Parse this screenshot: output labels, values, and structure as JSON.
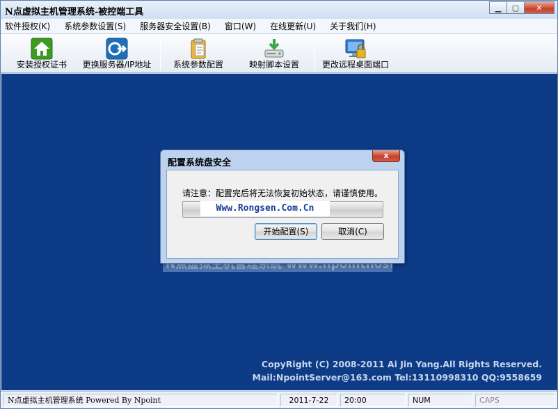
{
  "window": {
    "title": "N点虚拟主机管理系统-被控端工具",
    "minimize_glyph": "▁",
    "maximize_glyph": "▢",
    "close_glyph": "✕"
  },
  "menu": {
    "items": [
      {
        "label": "软件授权(K)"
      },
      {
        "label": "系统参数设置(S)"
      },
      {
        "label": "服务器安全设置(B)"
      },
      {
        "label": "窗口(W)"
      },
      {
        "label": "在线更新(U)"
      },
      {
        "label": "关于我们(H)"
      }
    ]
  },
  "toolbar": {
    "items": [
      {
        "label": "安装授权证书",
        "icon": "home-icon",
        "color": "#3c9b25"
      },
      {
        "label": "更换服务器/IP地址",
        "icon": "server-arrow-icon",
        "color": "#1e6fb8"
      },
      {
        "label": "系统参数配置",
        "icon": "clipboard-icon",
        "color": "#d9a72b"
      },
      {
        "label": "映射脚本设置",
        "icon": "download-drive-icon",
        "color": "#3aa64a"
      },
      {
        "label": "更改远程桌面端口",
        "icon": "monitor-lock-icon",
        "color": "#2d7bd6"
      }
    ]
  },
  "main": {
    "background_color": "#0e3b86",
    "watermark_text": "N点虚拟主机管理系统 www.npointhost.com",
    "copyright_line1": "CopyRight (C) 2008-2011 Ai Jin Yang.All Rights Reserved.",
    "copyright_line2": "Mail:NpointServer@163.com Tel:13110998310 QQ:9558659"
  },
  "dialog": {
    "title": "配置系统盘安全",
    "close_glyph": "x",
    "message": "请注意：配置完后将无法恢复初始状态，请谨慎使用。",
    "progress": 0,
    "overlay_text": "Www.Rongsen.Com.Cn",
    "start_button": "开始配置(S)",
    "cancel_button": "取消(C)"
  },
  "statusbar": {
    "app_text": "N点虚拟主机管理系统 Powered By Npoint",
    "date": "2011-7-22",
    "time": "20:00",
    "num": "NUM",
    "caps": "CAPS"
  }
}
